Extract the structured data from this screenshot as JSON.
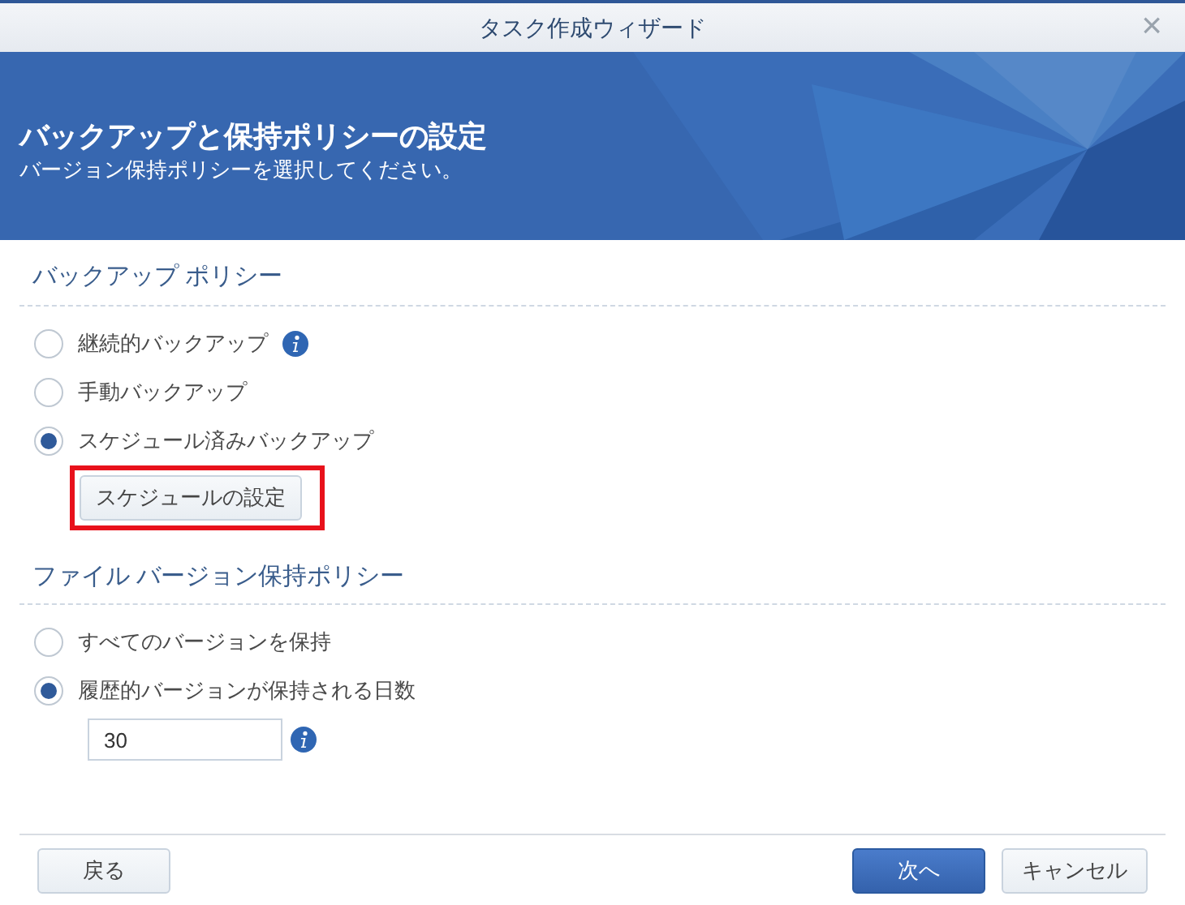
{
  "window": {
    "title": "タスク作成ウィザード",
    "close": "×"
  },
  "header": {
    "title": "バックアップと保持ポリシーの設定",
    "subtitle": "バージョン保持ポリシーを選択してください。"
  },
  "sections": [
    {
      "heading": "バックアップ ポリシー",
      "options": [
        {
          "label": "継続的バックアップ",
          "selected": false,
          "info": true
        },
        {
          "label": "手動バックアップ",
          "selected": false,
          "info": false
        },
        {
          "label": "スケジュール済みバックアップ",
          "selected": true,
          "info": false,
          "button": {
            "label": "スケジュールの設定",
            "highlighted": true
          }
        }
      ]
    },
    {
      "heading": "ファイル バージョン保持ポリシー",
      "options": [
        {
          "label": "すべてのバージョンを保持",
          "selected": false,
          "info": false
        },
        {
          "label": "履歴的バージョンが保持される日数",
          "selected": true,
          "info": false,
          "field": {
            "value": "30",
            "info": true
          }
        }
      ]
    }
  ],
  "footer": {
    "back": "戻る",
    "next": "次へ",
    "cancel": "キャンセル"
  }
}
